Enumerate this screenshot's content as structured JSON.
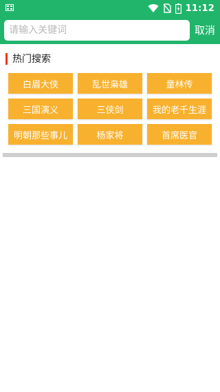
{
  "status_bar": {
    "time": "11:12",
    "icons": [
      "sim-card-icon",
      "wifi-icon",
      "no-sim-icon",
      "battery-charging-icon"
    ]
  },
  "search": {
    "placeholder": "请输入关键词",
    "value": "",
    "cancel_label": "取消"
  },
  "hot_search": {
    "title": "热门搜索",
    "accent_color": "#e8381c",
    "tag_color": "#f8b12e",
    "items": [
      "白眉大侠",
      "乱世枭雄",
      "童林传",
      "三国演义",
      "三侠剑",
      "我的老千生涯",
      "明朝那些事儿",
      "杨家将",
      "首席医官"
    ]
  },
  "colors": {
    "header_green": "#20b56b",
    "divider_gray": "#cfcfcf"
  }
}
